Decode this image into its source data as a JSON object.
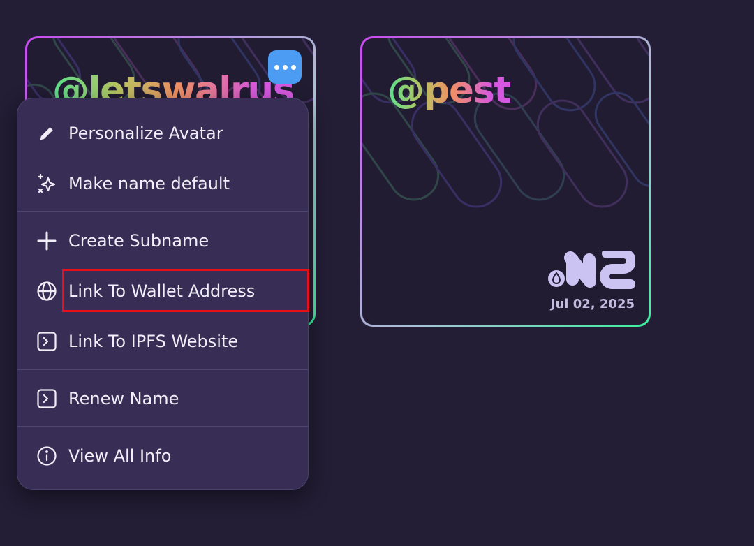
{
  "cards": [
    {
      "handle": "@letswalrus",
      "date": "",
      "more_button_label": "More options"
    },
    {
      "handle": "@pest",
      "date": "Jul 02, 2025",
      "logo_text": "NS"
    }
  ],
  "menu": {
    "items": [
      {
        "label": "Personalize Avatar",
        "icon": "pencil-icon"
      },
      {
        "label": "Make name default",
        "icon": "sparkles-icon"
      },
      {
        "label": "Create Subname",
        "icon": "plus-icon"
      },
      {
        "label": "Link To Wallet Address",
        "icon": "globe-icon"
      },
      {
        "label": "Link To IPFS Website",
        "icon": "terminal-icon"
      },
      {
        "label": "Renew Name",
        "icon": "terminal-icon"
      },
      {
        "label": "View All Info",
        "icon": "info-icon"
      }
    ]
  },
  "colors": {
    "background": "#231d35",
    "menu_background": "#372d55",
    "more_button": "#4c9cf3",
    "highlight": "#e8101a",
    "card_border_start": "#c84af0",
    "card_border_end": "#3cf0a0"
  }
}
